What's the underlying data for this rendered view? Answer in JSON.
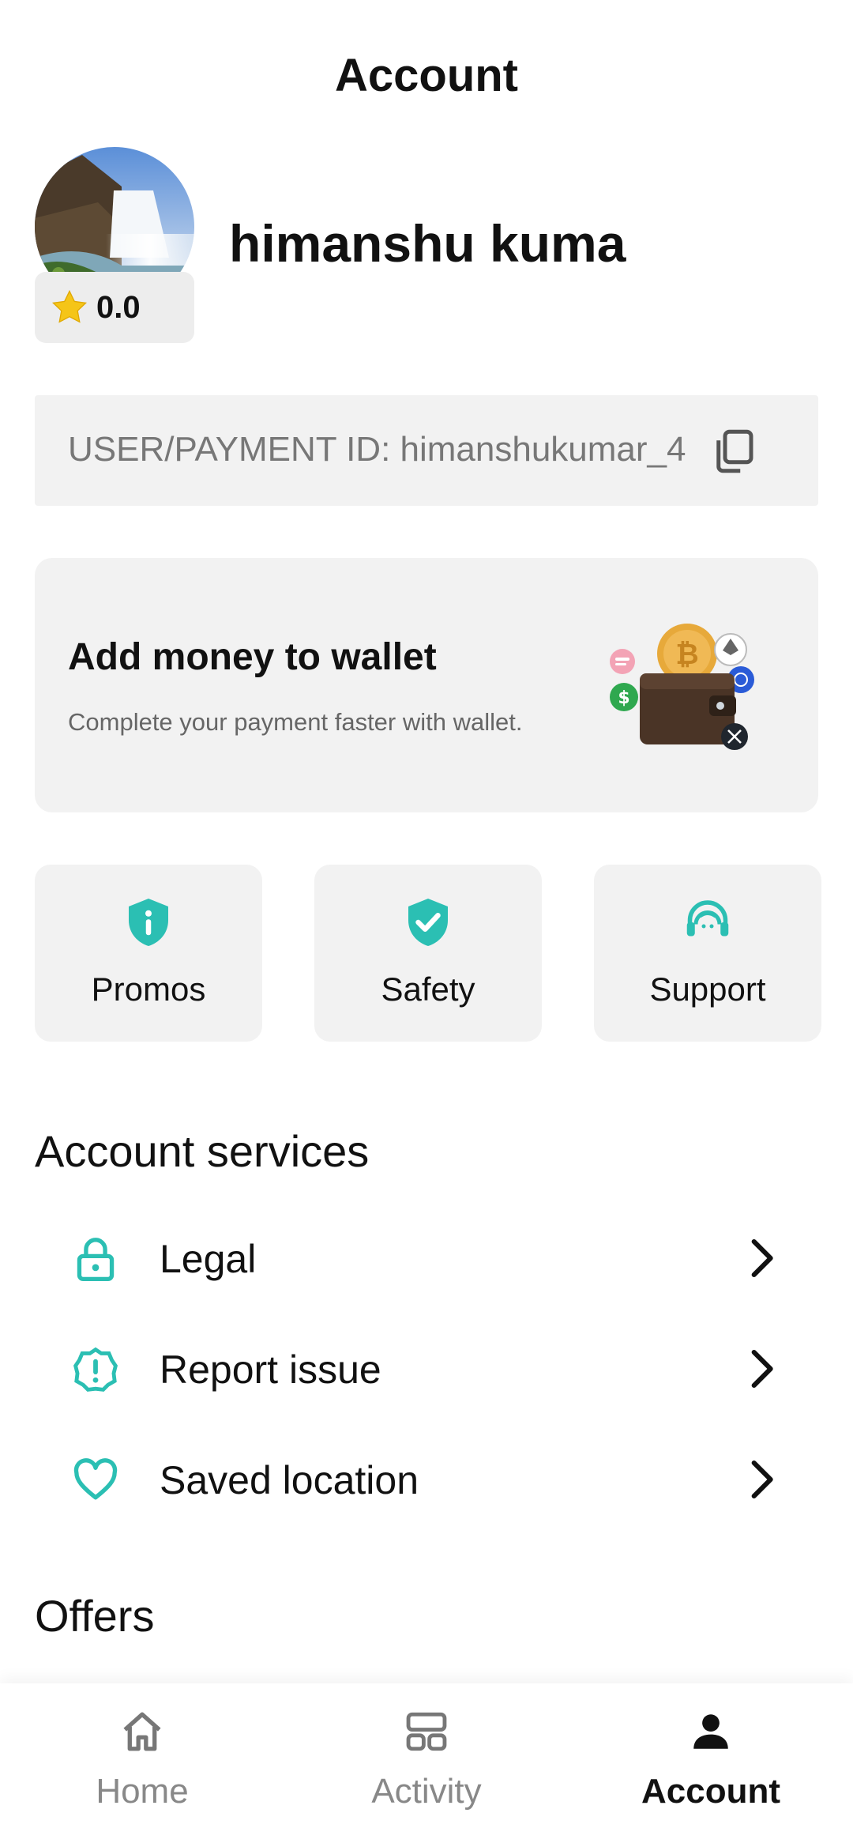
{
  "header": {
    "title": "Account"
  },
  "profile": {
    "name": "himanshu kuma",
    "rating": "0.0",
    "avatar_icon": "waterfall-landscape-avatar",
    "rating_icon": "star-icon"
  },
  "user_id": {
    "label": "USER/PAYMENT ID: himanshukumar_4",
    "copy_icon": "copy-icon"
  },
  "wallet": {
    "title": "Add money to wallet",
    "subtitle": "Complete your payment faster with wallet.",
    "illustration": "wallet-crypto-coins-illustration"
  },
  "quick_actions": [
    {
      "label": "Promos",
      "icon": "shield-info-icon"
    },
    {
      "label": "Safety",
      "icon": "shield-check-icon"
    },
    {
      "label": "Support",
      "icon": "headset-agent-icon"
    }
  ],
  "account_services": {
    "title": "Account services",
    "items": [
      {
        "label": "Legal",
        "icon": "lock-icon"
      },
      {
        "label": "Report issue",
        "icon": "alert-badge-icon"
      },
      {
        "label": "Saved location",
        "icon": "heart-icon"
      }
    ]
  },
  "offers": {
    "title": "Offers"
  },
  "bottom_nav": {
    "items": [
      {
        "label": "Home",
        "icon": "home-icon",
        "active": false
      },
      {
        "label": "Activity",
        "icon": "activity-grid-icon",
        "active": false
      },
      {
        "label": "Account",
        "icon": "person-icon",
        "active": true
      }
    ]
  },
  "colors": {
    "accent": "#2bbfb3",
    "card_bg": "#f2f2f2",
    "star": "#f5c518",
    "text_primary": "#111111",
    "text_muted": "#888888"
  }
}
